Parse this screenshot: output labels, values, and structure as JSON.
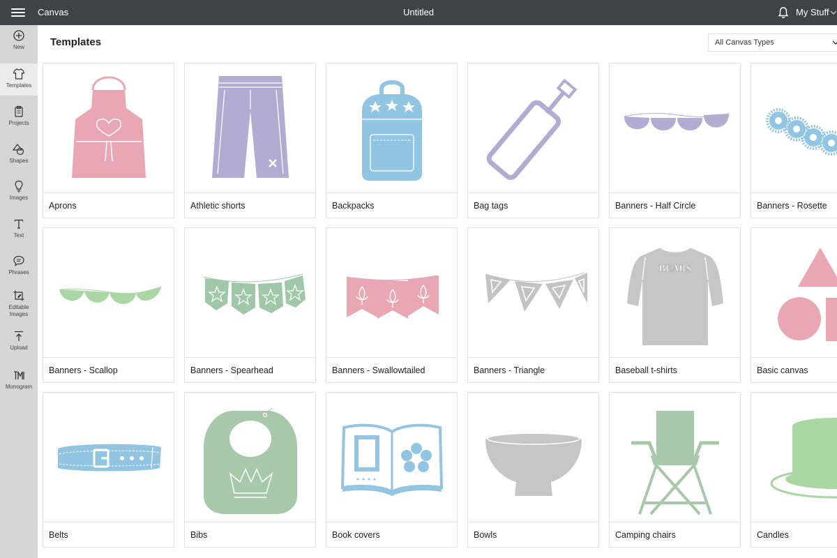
{
  "topbar": {
    "app_name": "Canvas",
    "doc_title": "Untitled",
    "my_stuff": "My Stuff"
  },
  "sidebar": {
    "items": [
      {
        "label": "New",
        "icon": "plus-circle-icon"
      },
      {
        "label": "Templates",
        "icon": "tshirt-icon"
      },
      {
        "label": "Projects",
        "icon": "clipboard-icon"
      },
      {
        "label": "Shapes",
        "icon": "shapes-icon"
      },
      {
        "label": "Images",
        "icon": "lightbulb-icon"
      },
      {
        "label": "Text",
        "icon": "text-icon"
      },
      {
        "label": "Phrases",
        "icon": "speech-bubble-icon"
      },
      {
        "label": "Editable Images",
        "icon": "edit-image-icon"
      },
      {
        "label": "Upload",
        "icon": "upload-icon"
      },
      {
        "label": "Monogram",
        "icon": "monogram-icon"
      }
    ],
    "active": "Templates"
  },
  "main": {
    "title": "Templates",
    "canvas_type_select": "All Canvas Types",
    "templates": [
      {
        "label": "Aprons",
        "icon": "apron-icon",
        "color": "#e9a7b4"
      },
      {
        "label": "Athletic shorts",
        "icon": "shorts-icon",
        "color": "#b3acd2"
      },
      {
        "label": "Backpacks",
        "icon": "backpack-icon",
        "color": "#92c5e2"
      },
      {
        "label": "Bag tags",
        "icon": "bag-tag-icon",
        "color": "#b3acd2"
      },
      {
        "label": "Banners - Half Circle",
        "icon": "banner-half-circle-icon",
        "color": "#b3acd2"
      },
      {
        "label": "Banners - Rosette",
        "icon": "banner-rosette-icon",
        "color": "#92c5e2"
      },
      {
        "label": "Banners - Scallop",
        "icon": "banner-scallop-icon",
        "color": "#a9d6a2"
      },
      {
        "label": "Banners - Spearhead",
        "icon": "banner-spearhead-icon",
        "color": "#9fc7a8"
      },
      {
        "label": "Banners - Swallowtailed",
        "icon": "banner-swallowtailed-icon",
        "color": "#e9a7b4"
      },
      {
        "label": "Banners - Triangle",
        "icon": "banner-triangle-icon",
        "color": "#c3c3c3"
      },
      {
        "label": "Baseball t-shirts",
        "icon": "baseball-shirt-icon",
        "color": "#c6c6c6",
        "text": "BEARS"
      },
      {
        "label": "Basic canvas",
        "icon": "basic-shapes-icon",
        "color": "#e9a7b4"
      },
      {
        "label": "Belts",
        "icon": "belt-icon",
        "color": "#92c5e2"
      },
      {
        "label": "Bibs",
        "icon": "bib-icon",
        "color": "#a8c8aa"
      },
      {
        "label": "Book covers",
        "icon": "book-icon",
        "color": "#92c5e2"
      },
      {
        "label": "Bowls",
        "icon": "bowl-icon",
        "color": "#c6c6c6"
      },
      {
        "label": "Camping chairs",
        "icon": "camping-chair-icon",
        "color": "#a8c8aa"
      },
      {
        "label": "Candles",
        "icon": "candle-icon",
        "color": "#a9d6a2"
      }
    ]
  }
}
